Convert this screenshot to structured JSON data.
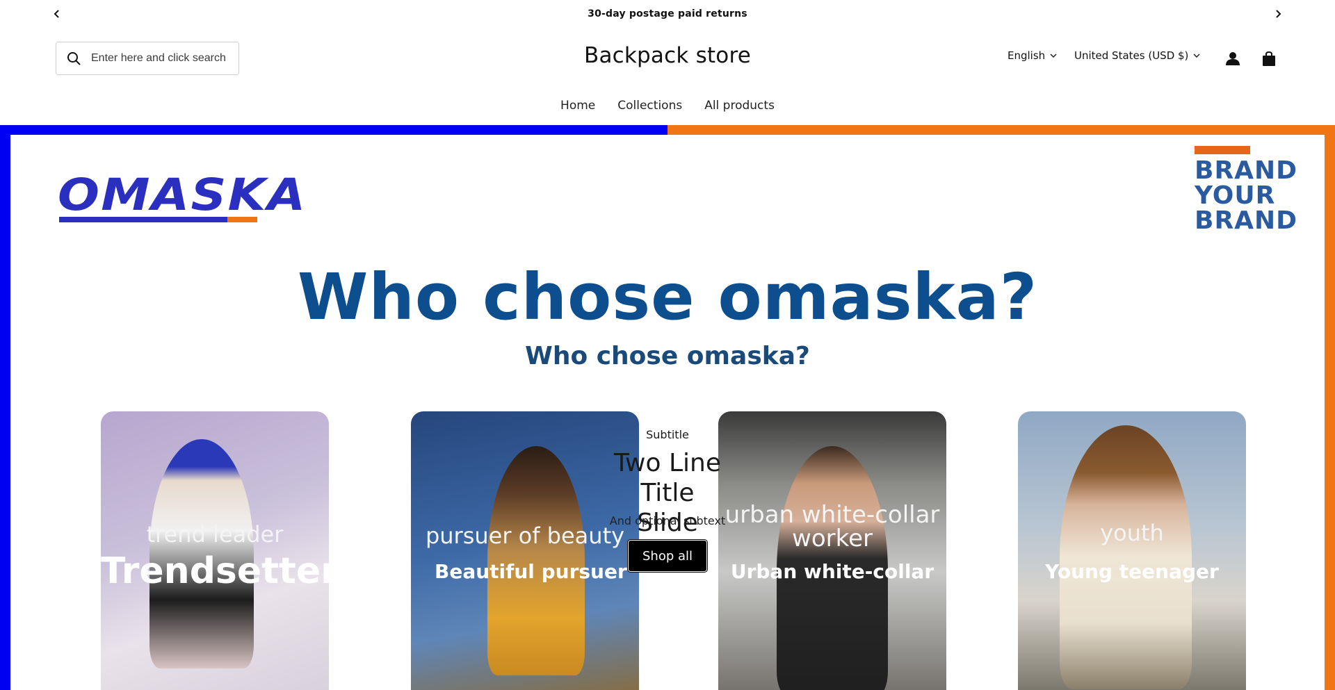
{
  "announcement": {
    "text": "30-day postage paid returns"
  },
  "header": {
    "search_placeholder": "Enter here and click search",
    "store_name": "Backpack store",
    "language": "English",
    "currency": "United States (USD $)"
  },
  "nav": {
    "items": [
      "Home",
      "Collections",
      "All products"
    ]
  },
  "banner": {
    "logo_text": "OMASKA",
    "brand_lines": [
      "BRAND",
      "YOUR",
      "BRAND"
    ],
    "headline": "Who chose omaska?",
    "subheadline": "Who chose omaska?",
    "cards": [
      {
        "small": "trend leader",
        "big": "Trendsetter"
      },
      {
        "small": "pursuer of beauty",
        "big": "Beautiful pursuer"
      },
      {
        "small": "urban white-collar worker",
        "big": "Urban white-collar"
      },
      {
        "small": "youth",
        "big": "Young teenager"
      }
    ]
  },
  "slide_overlay": {
    "subtitle": "Subtitle",
    "title_line1": "Two Line",
    "title_line2": "Title Slide",
    "subtext": "And optional subtext",
    "button": "Shop all"
  },
  "colors": {
    "band_left": "#0000f2",
    "band_right": "#f07514",
    "headline": "#0d4f8e",
    "button_bg": "#000000"
  }
}
